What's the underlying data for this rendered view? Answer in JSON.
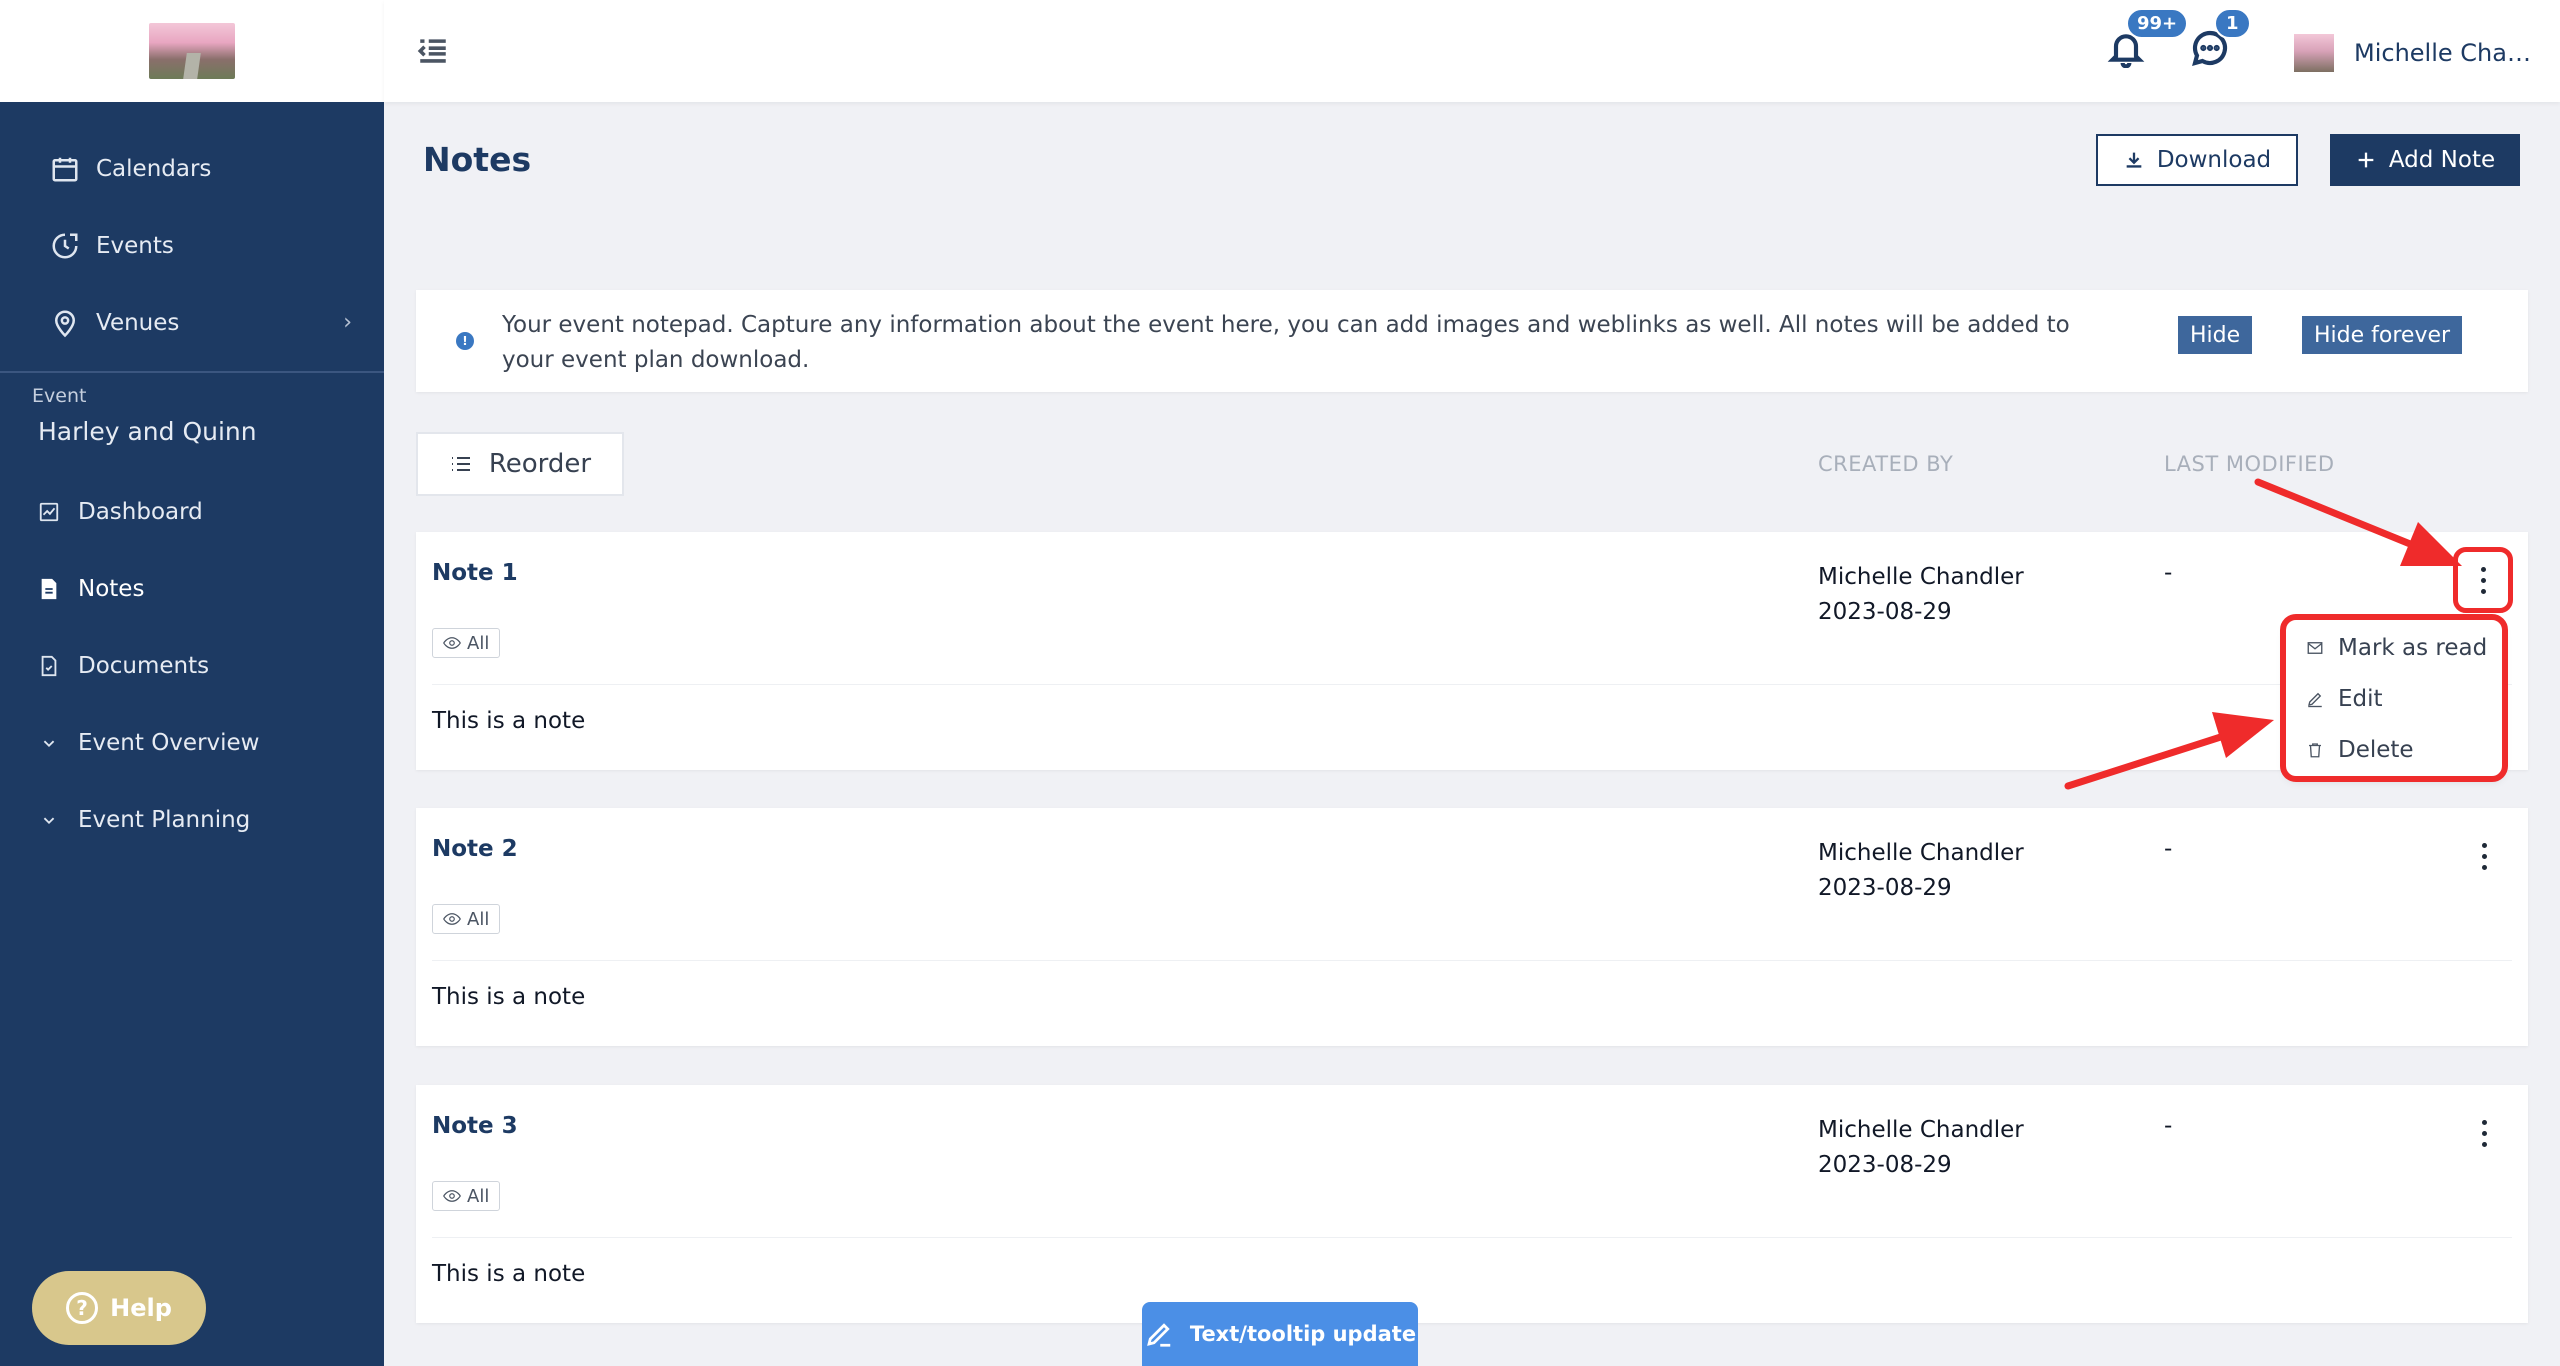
{
  "topbar": {
    "notifications_badge": "99+",
    "messages_badge": "1",
    "user_name": "Michelle Chan..."
  },
  "sidebar": {
    "items": [
      {
        "label": "Calendars",
        "icon": "calendar-icon"
      },
      {
        "label": "Events",
        "icon": "clock-icon"
      },
      {
        "label": "Venues",
        "icon": "location-pin-icon"
      }
    ],
    "section_label": "Event",
    "event_name": "Harley and Quinn",
    "sub_items": [
      {
        "label": "Dashboard",
        "icon": "chart-icon"
      },
      {
        "label": "Notes",
        "icon": "document-icon",
        "active": true
      },
      {
        "label": "Documents",
        "icon": "file-check-icon"
      },
      {
        "label": "Event Overview",
        "icon": "chevron-down-icon"
      },
      {
        "label": "Event Planning",
        "icon": "chevron-down-icon"
      }
    ],
    "help_label": "Help"
  },
  "page": {
    "title": "Notes",
    "download_label": "Download",
    "add_note_label": "Add Note"
  },
  "info": {
    "text": "Your event notepad. Capture any information about the event here, you can add images and weblinks as well. All notes will be added to your event plan download.",
    "hide_label": "Hide",
    "hide_forever_label": "Hide forever"
  },
  "list": {
    "reorder_label": "Reorder",
    "col_created_by": "CREATED BY",
    "col_last_modified": "LAST MODIFIED"
  },
  "notes": [
    {
      "title": "Note 1",
      "tag": "All",
      "body": "This is a note",
      "creator": "Michelle Chandler",
      "created_date": "2023-08-29",
      "modified": "-"
    },
    {
      "title": "Note 2",
      "tag": "All",
      "body": "This is a note",
      "creator": "Michelle Chandler",
      "created_date": "2023-08-29",
      "modified": "-"
    },
    {
      "title": "Note 3",
      "tag": "All",
      "body": "This is a note",
      "creator": "Michelle Chandler",
      "created_date": "2023-08-29",
      "modified": "-"
    }
  ],
  "dropdown": {
    "items": [
      {
        "label": "Mark as read",
        "icon": "envelope-icon"
      },
      {
        "label": "Edit",
        "icon": "pencil-icon"
      },
      {
        "label": "Delete",
        "icon": "trash-icon"
      }
    ]
  },
  "footer": {
    "tooltip_update_label": "Text/tooltip update"
  },
  "colors": {
    "sidebar": "#1d3a63",
    "accent": "#3a78c2",
    "annotation_red": "#ef2b2b",
    "help": "#d8c78c"
  }
}
